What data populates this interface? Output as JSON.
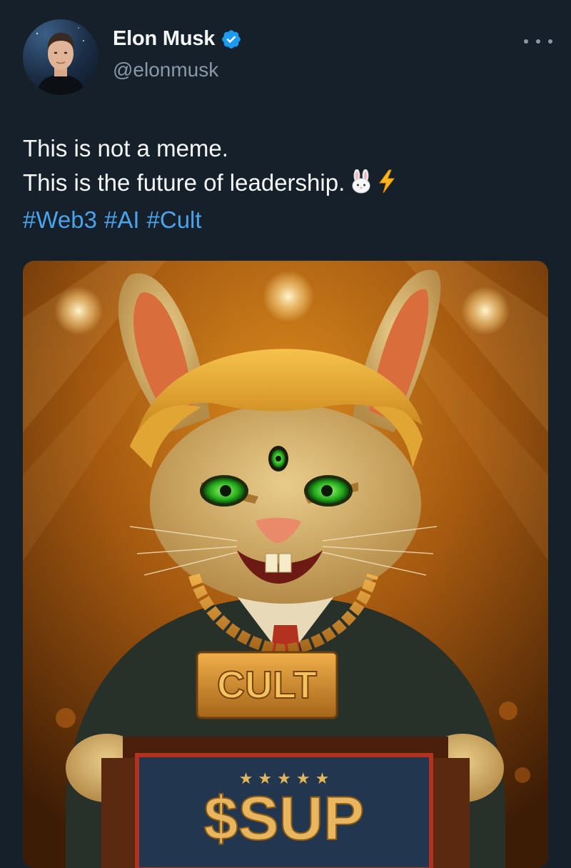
{
  "author": {
    "name": "Elon Musk",
    "handle": "@elonmusk",
    "verified": true,
    "verified_icon": "verified-badge-icon",
    "avatar_icon": "avatar-icon"
  },
  "menu": {
    "icon": "more-options-icon"
  },
  "tweet": {
    "line1": "This is not a meme.",
    "line2": "This is the future of leadership.",
    "emojis": [
      "rabbit-face-icon",
      "lightning-icon"
    ],
    "hashtags": [
      "#Web3",
      "#AI",
      "#Cult"
    ]
  },
  "media": {
    "description_icon": "rabbit-leader-image",
    "necklace_plate_text": "CULT",
    "podium_sign_text": "$SUP",
    "podium_stars": "★ ★ ★ ★ ★"
  },
  "colors": {
    "background": "#15202b",
    "text": "#f7f9f9",
    "secondary_text": "#8b98a5",
    "hashtag": "#4ba3ea",
    "verified_blue": "#1d9bf0"
  }
}
